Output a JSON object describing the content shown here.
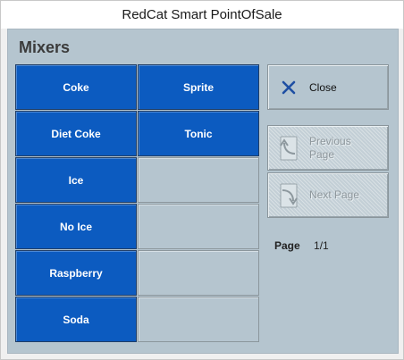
{
  "window": {
    "title": "RedCat Smart PointOfSale"
  },
  "panel": {
    "title": "Mixers"
  },
  "items": [
    {
      "label": "Coke"
    },
    {
      "label": "Sprite"
    },
    {
      "label": "Diet Coke"
    },
    {
      "label": "Tonic"
    },
    {
      "label": "Ice"
    },
    {
      "label": ""
    },
    {
      "label": "No Ice"
    },
    {
      "label": ""
    },
    {
      "label": "Raspberry"
    },
    {
      "label": ""
    },
    {
      "label": "Soda"
    },
    {
      "label": ""
    }
  ],
  "actions": {
    "close_label": "Close",
    "previous_label": "Previous\nPage",
    "next_label": "Next Page"
  },
  "pagination": {
    "label": "Page",
    "value": "1/1"
  },
  "colors": {
    "accent": "#0c5bc0",
    "panel": "#b5c5cf",
    "close_icon": "#1e4fa3"
  },
  "icons": {
    "close": "close-x-icon",
    "previous": "previous-page-icon",
    "next": "next-page-icon"
  }
}
